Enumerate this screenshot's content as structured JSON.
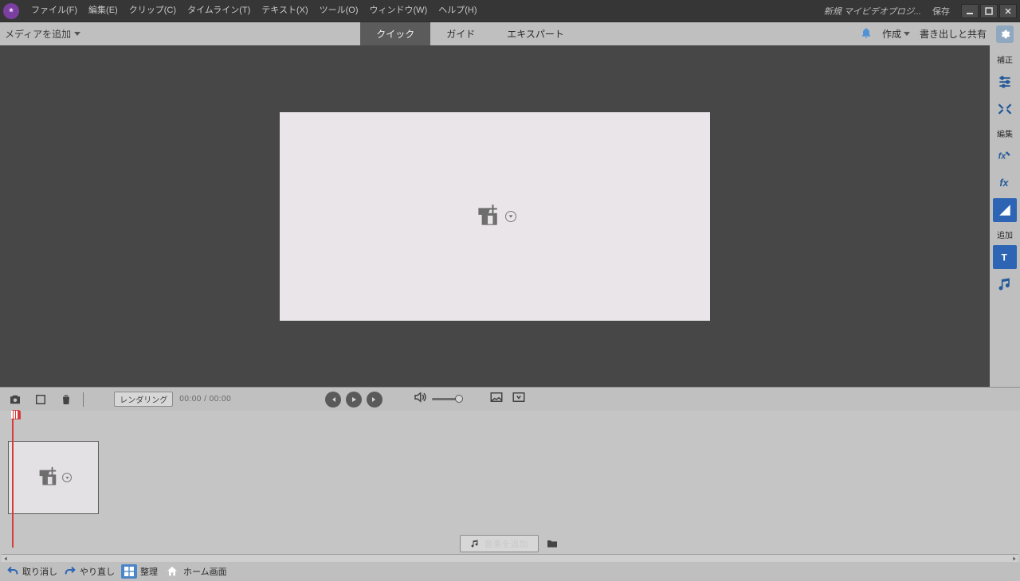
{
  "menus": {
    "file": "ファイル(F)",
    "edit": "編集(E)",
    "clip": "クリップ(C)",
    "timeline": "タイムライン(T)",
    "text": "テキスト(X)",
    "tool": "ツール(O)",
    "window": "ウィンドウ(W)",
    "help": "ヘルプ(H)"
  },
  "project_name": "新規 マイビデオプロジ...",
  "save": "保存",
  "media_dropdown": "メディアを追加",
  "tabs": {
    "quick": "クイック",
    "guide": "ガイド",
    "expert": "エキスパート"
  },
  "create": "作成",
  "export_share": "書き出しと共有",
  "rail": {
    "correct": "補正",
    "edit": "編集",
    "add": "追加"
  },
  "transport": {
    "render": "レンダリング",
    "timecode": "00:00 / 00:00"
  },
  "music_add": "音楽を追加",
  "bottom": {
    "undo": "取り消し",
    "redo": "やり直し",
    "organize": "整理",
    "home": "ホーム画面"
  }
}
